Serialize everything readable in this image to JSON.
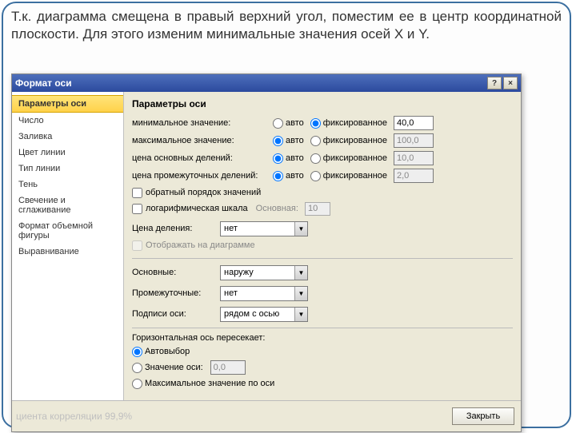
{
  "intro": "Т.к. диаграмма смещена в правый верхний угол, поместим ее в центр координатной плоскости. Для этого изменим минимальные значения осей X и Y.",
  "dialog": {
    "title": "Формат оси",
    "help_btn": "?",
    "close_btn": "×"
  },
  "sidebar": {
    "items": [
      "Параметры оси",
      "Число",
      "Заливка",
      "Цвет линии",
      "Тип линии",
      "Тень",
      "Свечение и сглаживание",
      "Формат объемной фигуры",
      "Выравнивание"
    ]
  },
  "panel": {
    "heading": "Параметры оси",
    "rows": [
      {
        "label": "минимальное значение:",
        "auto": "авто",
        "fixed": "фиксированное",
        "value": "40,0",
        "fixed_selected": true,
        "enabled": true
      },
      {
        "label": "максимальное значение:",
        "auto": "авто",
        "fixed": "фиксированное",
        "value": "100,0",
        "fixed_selected": false,
        "enabled": false
      },
      {
        "label": "цена основных делений:",
        "auto": "авто",
        "fixed": "фиксированное",
        "value": "10,0",
        "fixed_selected": false,
        "enabled": false
      },
      {
        "label": "цена промежуточных делений:",
        "auto": "авто",
        "fixed": "фиксированное",
        "value": "2,0",
        "fixed_selected": false,
        "enabled": false
      }
    ],
    "chk_reverse": "обратный порядок значений",
    "chk_log": "логарифмическая шкала",
    "log_base_label": "Основная:",
    "log_base_value": "10",
    "price_div_label": "Цена деления:",
    "price_div_value": "нет",
    "chk_show": "Отображать на диаграмме",
    "ticks": {
      "major_label": "Основные:",
      "major_value": "наружу",
      "minor_label": "Промежуточные:",
      "minor_value": "нет",
      "labels_label": "Подписи оси:",
      "labels_value": "рядом с осью"
    },
    "crosses": {
      "group": "Горизонтальная ось пересекает:",
      "auto": "Автовыбор",
      "at": "Значение оси:",
      "at_value": "0,0",
      "max": "Максимальное значение по оси"
    }
  },
  "footer": {
    "close": "Закрыть"
  },
  "under": "циента корреляции 99,9%"
}
